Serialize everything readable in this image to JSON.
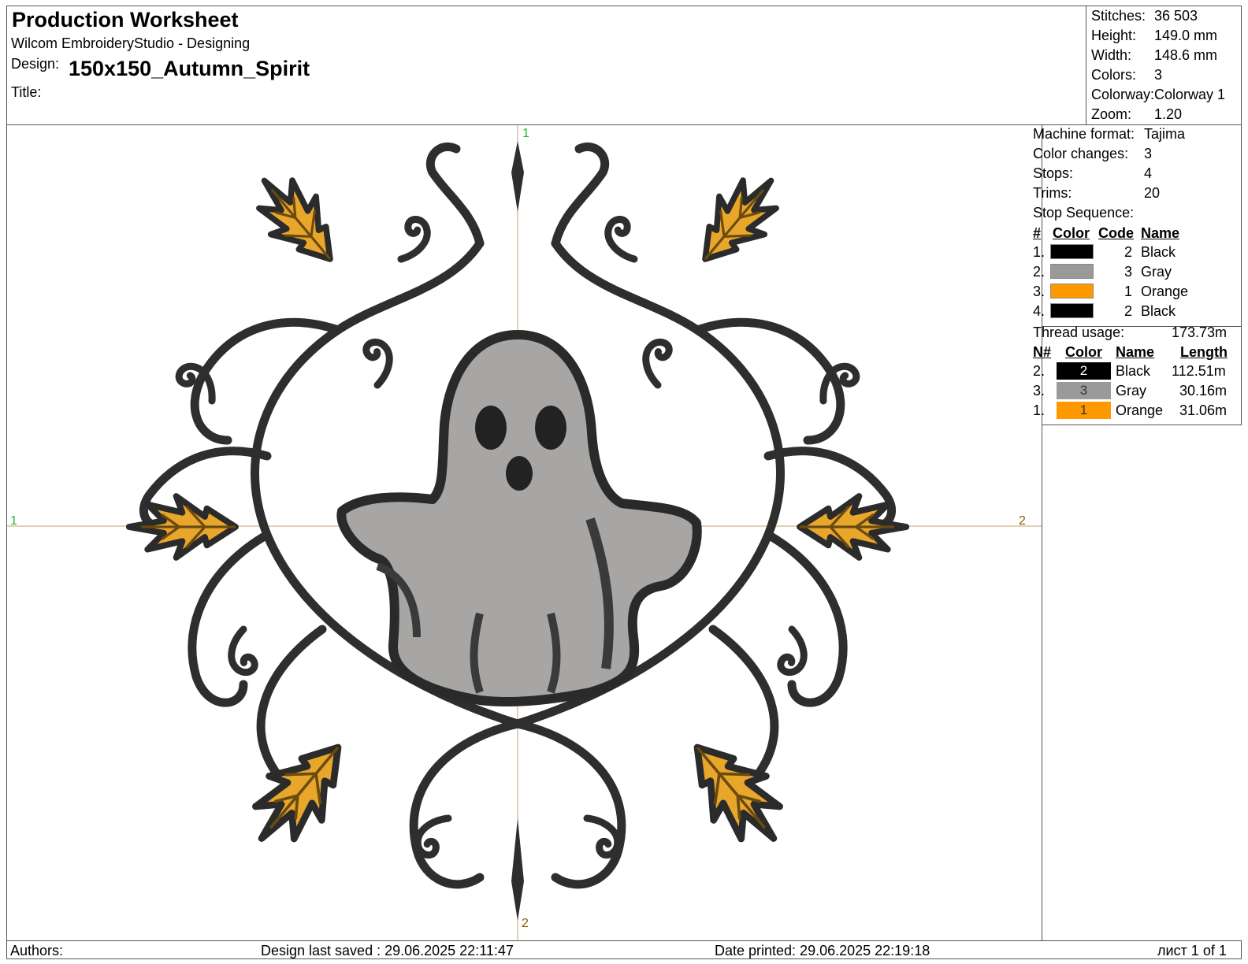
{
  "header": {
    "title": "Production Worksheet",
    "app": "Wilcom EmbroideryStudio - Designing",
    "design_label": "Design:",
    "design_name": "150x150_Autumn_Spirit",
    "title_label": "Title:"
  },
  "stats": [
    {
      "label": "Stitches:",
      "value": "36 503"
    },
    {
      "label": "Height:",
      "value": "149.0 mm"
    },
    {
      "label": "Width:",
      "value": "148.6 mm"
    },
    {
      "label": "Colors:",
      "value": "3"
    },
    {
      "label": "Colorway:",
      "value": "Colorway 1"
    },
    {
      "label": "Zoom:",
      "value": "1.20"
    }
  ],
  "machine": {
    "rows": [
      {
        "label": "Machine format:",
        "value": "Tajima"
      },
      {
        "label": "Color changes:",
        "value": "3"
      },
      {
        "label": "Stops:",
        "value": "4"
      },
      {
        "label": "Trims:",
        "value": "20"
      }
    ],
    "stop_sequence_label": "Stop Sequence:",
    "headers": {
      "num": "#",
      "color": "Color",
      "code": "Code",
      "name": "Name"
    },
    "stops": [
      {
        "num": "1.",
        "color": "#000000",
        "code": "2",
        "name": "Black"
      },
      {
        "num": "2.",
        "color": "#9a9a9a",
        "code": "3",
        "name": "Gray"
      },
      {
        "num": "3.",
        "color": "#ff9900",
        "code": "1",
        "name": "Orange"
      },
      {
        "num": "4.",
        "color": "#000000",
        "code": "2",
        "name": "Black"
      }
    ]
  },
  "threads": {
    "usage_label": "Thread usage:",
    "usage_value": "173.73m",
    "headers": {
      "num": "N#",
      "color": "Color",
      "name": "Name",
      "length": "Length"
    },
    "rows": [
      {
        "num": "2.",
        "color": "#000000",
        "code": "2",
        "name": "Black",
        "length": "112.51m"
      },
      {
        "num": "3.",
        "color": "#9a9a9a",
        "code": "3",
        "name": "Gray",
        "length": "30.16m"
      },
      {
        "num": "1.",
        "color": "#ff9900",
        "code": "1",
        "name": "Orange",
        "length": "31.06m"
      }
    ]
  },
  "design_markers": {
    "top": "1",
    "left": "1",
    "right": "2",
    "bottom": "2"
  },
  "footer": {
    "authors_label": "Authors:",
    "last_saved": "Design last saved : 29.06.2025 22:11:47",
    "date_printed": "Date printed: 29.06.2025 22:19:18",
    "page": "лист 1 of 1"
  }
}
